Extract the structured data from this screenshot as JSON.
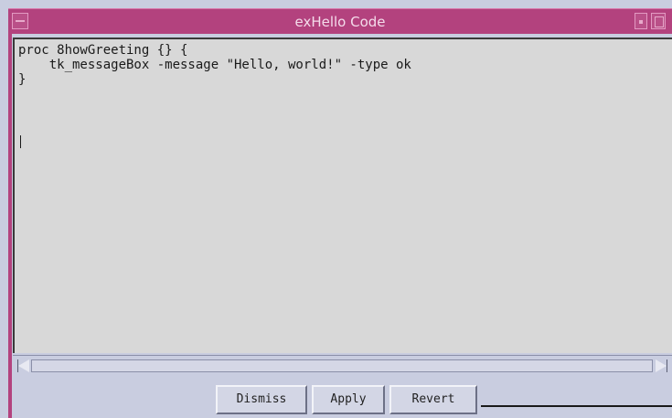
{
  "window": {
    "title": "exHello Code"
  },
  "editor": {
    "code": "proc 8howGreeting {} {\n    tk_messageBox -message \"Hello, world!\" -type ok\n}"
  },
  "buttons": {
    "dismiss": "Dismiss",
    "apply": "Apply",
    "revert": "Revert"
  },
  "icons": {
    "window_menu": "window-menu-icon",
    "minimize": "minimize-icon",
    "maximize": "maximize-icon",
    "scroll_left": "arrow-left-icon",
    "scroll_right": "arrow-right-icon"
  },
  "colors": {
    "titlebar": "#b3427e",
    "title_text": "#f4dceb",
    "editor_bg": "#d8d8d8",
    "chrome": "#c9cde0"
  }
}
